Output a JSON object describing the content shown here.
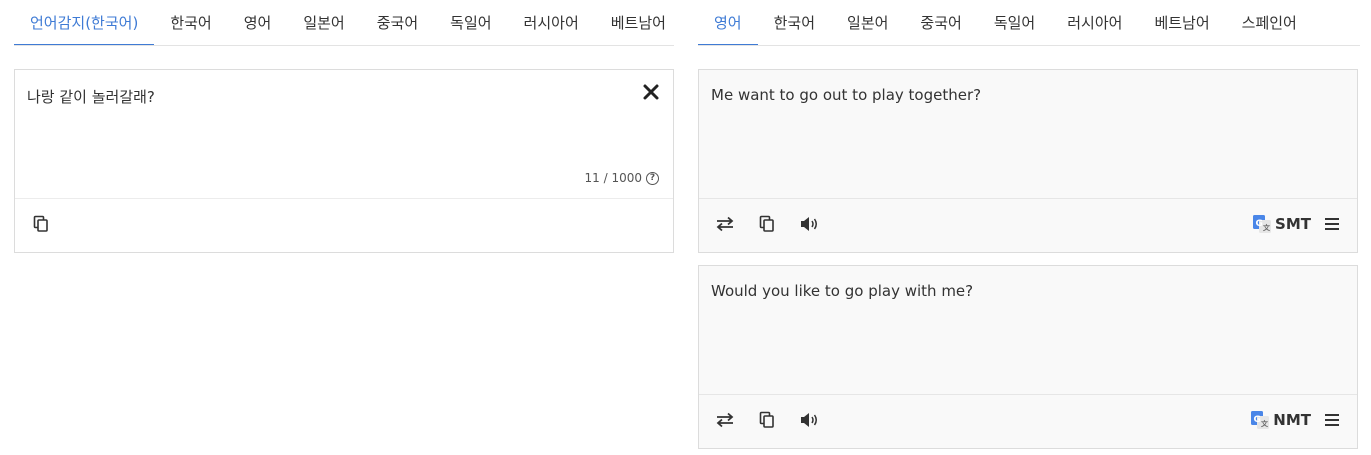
{
  "source_tabs": [
    {
      "label": "언어감지(한국어)",
      "active": true
    },
    {
      "label": "한국어",
      "active": false
    },
    {
      "label": "영어",
      "active": false
    },
    {
      "label": "일본어",
      "active": false
    },
    {
      "label": "중국어",
      "active": false
    },
    {
      "label": "독일어",
      "active": false
    },
    {
      "label": "러시아어",
      "active": false
    },
    {
      "label": "베트남어",
      "active": false
    }
  ],
  "target_tabs": [
    {
      "label": "영어",
      "active": true
    },
    {
      "label": "한국어",
      "active": false
    },
    {
      "label": "일본어",
      "active": false
    },
    {
      "label": "중국어",
      "active": false
    },
    {
      "label": "독일어",
      "active": false
    },
    {
      "label": "러시아어",
      "active": false
    },
    {
      "label": "베트남어",
      "active": false
    },
    {
      "label": "스페인어",
      "active": false
    }
  ],
  "source": {
    "text": "나랑 같이 놀러갈래?",
    "counter": "11 / 1000",
    "help_icon": "?"
  },
  "results": [
    {
      "text": "Me want to go out to play together?",
      "engine": "SMT"
    },
    {
      "text": "Would you like to go play with me?",
      "engine": "NMT"
    }
  ],
  "colors": {
    "accent": "#3f7bd5",
    "google_blue": "#4a86e8"
  }
}
